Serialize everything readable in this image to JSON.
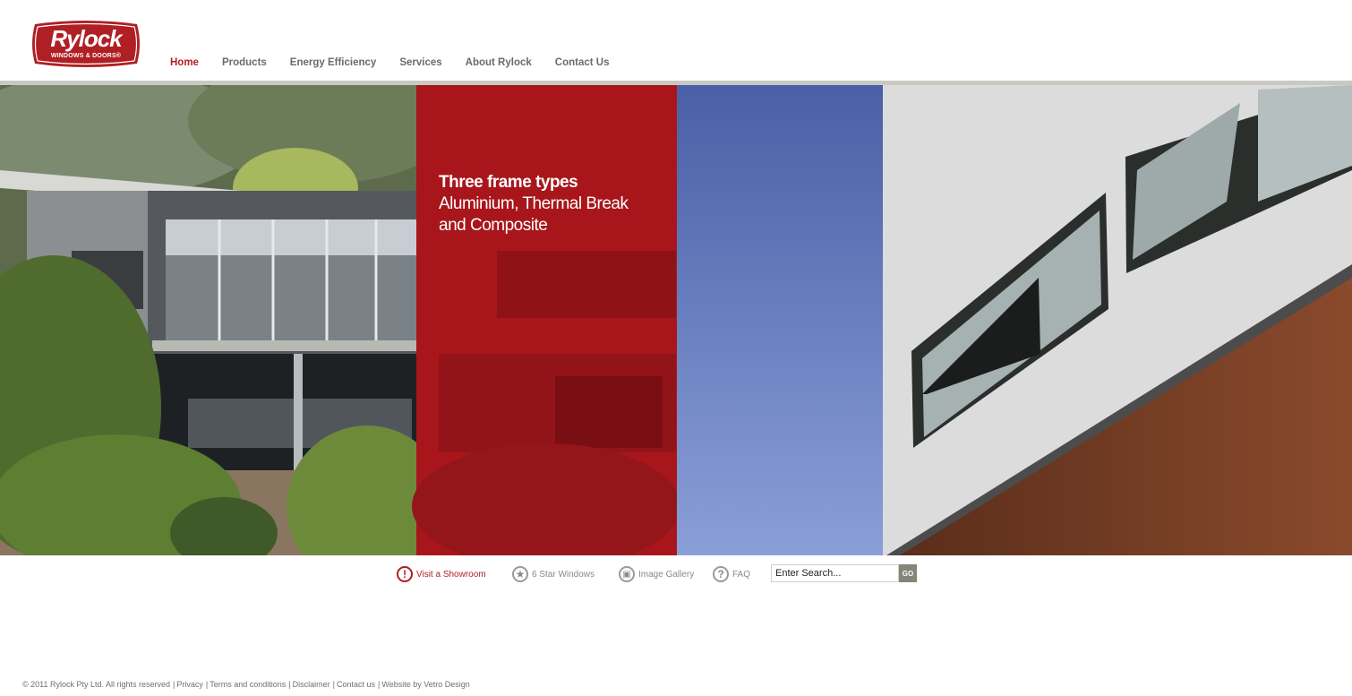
{
  "logo": {
    "word": "Rylock",
    "sub": "WINDOWS & DOORS®",
    "color": "#b01f24"
  },
  "nav": {
    "items": [
      {
        "label": "Home",
        "active": true
      },
      {
        "label": "Products"
      },
      {
        "label": "Energy Efficiency"
      },
      {
        "label": "Services"
      },
      {
        "label": "About Rylock"
      },
      {
        "label": "Contact Us"
      }
    ]
  },
  "hero": {
    "heading": "Three frame types",
    "line1": "Aluminium, Thermal Break",
    "line2": "and Composite",
    "accent": "#b01f24"
  },
  "quick_links": {
    "showroom": {
      "label": "Visit a Showroom",
      "icon": "exclamation-icon",
      "glyph": "!"
    },
    "star": {
      "label": "6 Star Windows",
      "icon": "star-icon",
      "glyph": "★"
    },
    "gallery": {
      "label": "Image Gallery",
      "icon": "gallery-icon",
      "glyph": "▣"
    },
    "faq": {
      "label": "FAQ",
      "icon": "question-icon",
      "glyph": "?"
    }
  },
  "search": {
    "placeholder": "Enter Search...",
    "button": "GO"
  },
  "footer": {
    "copyright": "© 2011 Rylock Pty Ltd. All rights reserved",
    "links": [
      "Privacy",
      "Terms and conditions",
      "Disclaimer",
      "Contact us",
      "Website by Vetro Design"
    ],
    "separator": "|"
  }
}
